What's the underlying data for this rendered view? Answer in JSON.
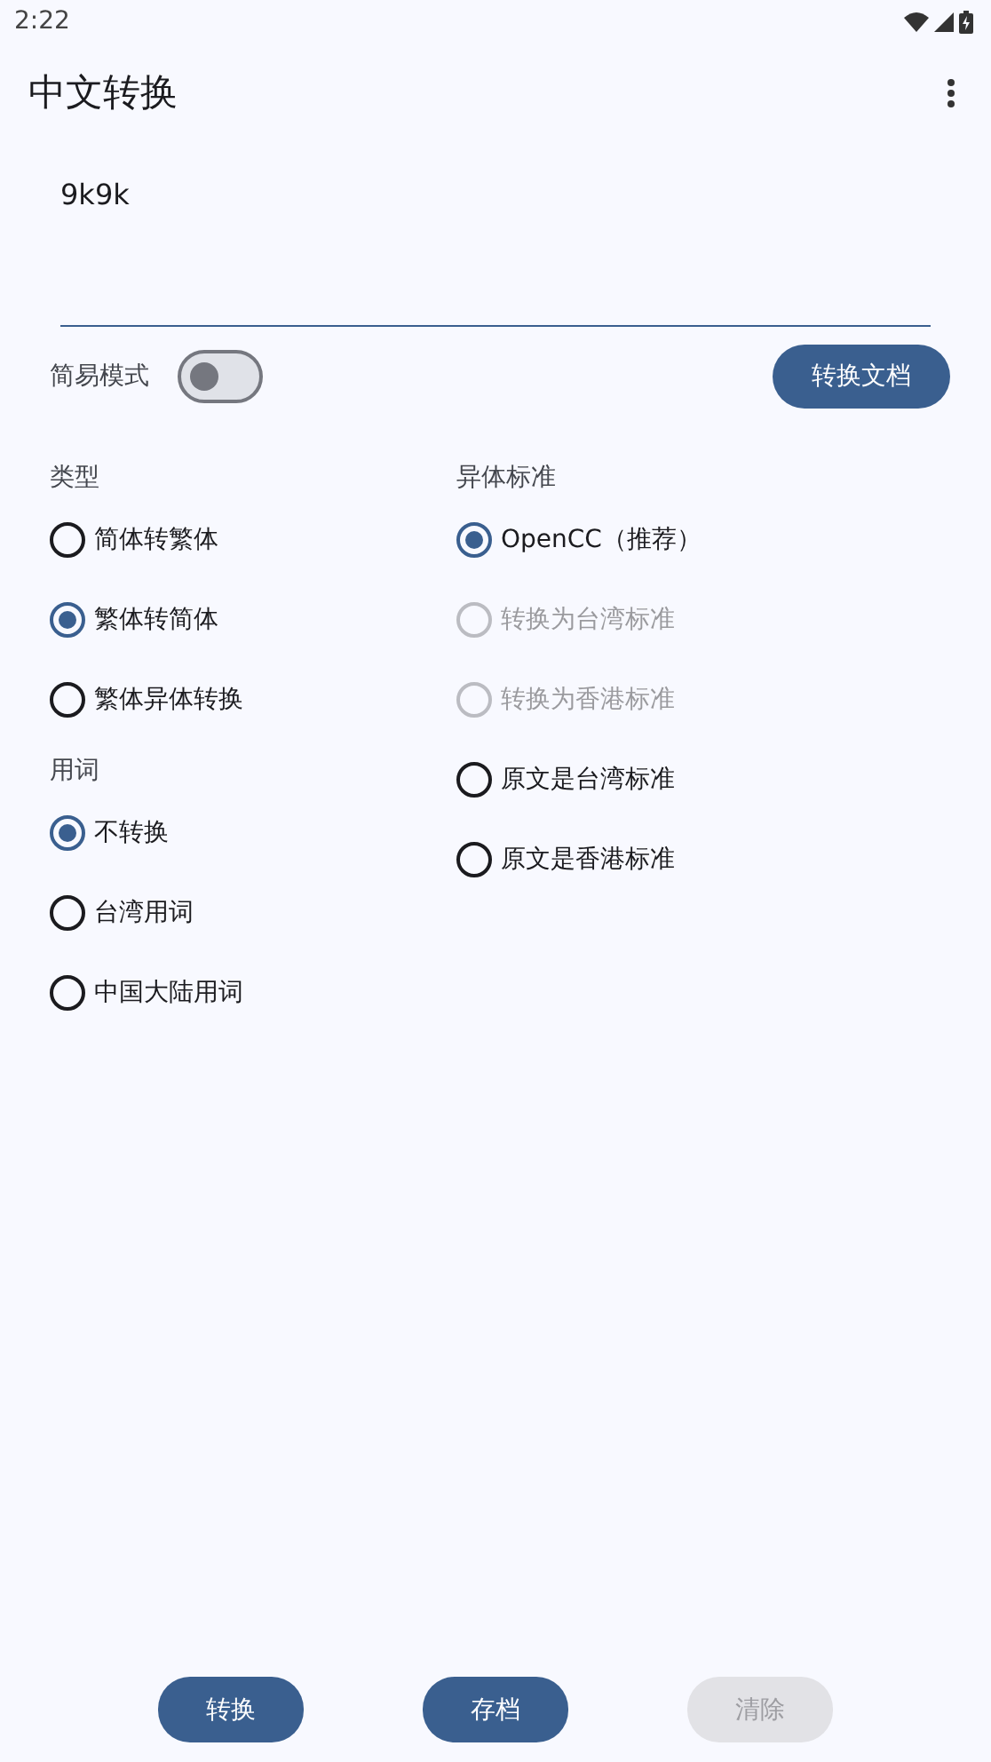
{
  "status_bar": {
    "time": "2:22"
  },
  "app_bar": {
    "title": "中文转换"
  },
  "input": {
    "value": "9k9k"
  },
  "simple_mode": {
    "label": "简易模式",
    "on": false
  },
  "convert_document_button": {
    "label": "转换文档"
  },
  "left_sections": [
    {
      "heading": "类型",
      "options": [
        {
          "label": "简体转繁体",
          "selected": false,
          "disabled": false
        },
        {
          "label": "繁体转简体",
          "selected": true,
          "disabled": false
        },
        {
          "label": "繁体异体转换",
          "selected": false,
          "disabled": false
        }
      ]
    },
    {
      "heading": "用词",
      "options": [
        {
          "label": "不转换",
          "selected": true,
          "disabled": false
        },
        {
          "label": "台湾用词",
          "selected": false,
          "disabled": false
        },
        {
          "label": "中国大陆用词",
          "selected": false,
          "disabled": false
        }
      ]
    }
  ],
  "right_sections": [
    {
      "heading": "异体标准",
      "options": [
        {
          "label": "OpenCC（推荐）",
          "selected": true,
          "disabled": false
        },
        {
          "label": "转换为台湾标准",
          "selected": false,
          "disabled": true
        },
        {
          "label": "转换为香港标准",
          "selected": false,
          "disabled": true
        },
        {
          "label": "原文是台湾标准",
          "selected": false,
          "disabled": false
        },
        {
          "label": "原文是香港标准",
          "selected": false,
          "disabled": false
        }
      ]
    }
  ],
  "bottom_buttons": [
    {
      "label": "转换",
      "disabled": false
    },
    {
      "label": "存档",
      "disabled": false
    },
    {
      "label": "清除",
      "disabled": true
    }
  ]
}
